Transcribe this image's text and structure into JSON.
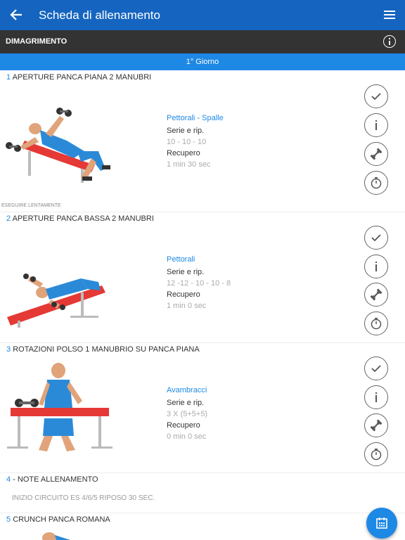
{
  "appbar": {
    "title": "Scheda di allenamento"
  },
  "section": {
    "label": "DIMAGRIMENTO"
  },
  "day": {
    "label": "1° Giorno"
  },
  "labels": {
    "series": "Serie e rip.",
    "rest": "Recupero"
  },
  "exercises": [
    {
      "num": "1",
      "title": "APERTURE PANCA PIANA 2 MANUBRI",
      "muscle": "Pettorali - Spalle",
      "reps": "10 - 10 - 10",
      "rest": "1 min 30 sec",
      "note": "ESEGUIRE LENTAMENTE"
    },
    {
      "num": "2",
      "title": "APERTURE PANCA BASSA 2 MANUBRI",
      "muscle": "Pettorali",
      "reps": "12 -12 - 10 - 10 - 8",
      "rest": "1 min 0 sec"
    },
    {
      "num": "3",
      "title": "ROTAZIONI POLSO 1 MANUBRIO SU PANCA PIANA",
      "muscle": "Avambracci",
      "reps": "3 X (5+5+5)",
      "rest": "0 min 0 sec"
    }
  ],
  "notes": {
    "num": "4",
    "title": " - NOTE ALLENAMENTO",
    "text": "INIZIO CIRCUITO ES 4/6/5 RIPOSO 30 SEC."
  },
  "ex5": {
    "num": "5",
    "title": "CRUNCH PANCA ROMANA"
  },
  "icons": [
    "back-arrow-icon",
    "menu-icon",
    "info-icon",
    "check-icon",
    "dumbbell-icon",
    "stopwatch-icon",
    "calendar-icon"
  ],
  "colors": {
    "appbar": "#1565c0",
    "section": "#333333",
    "day": "#1e88e5",
    "accent": "#1e88e5",
    "bench": "#e53935",
    "shirt": "#2b8ad8"
  }
}
